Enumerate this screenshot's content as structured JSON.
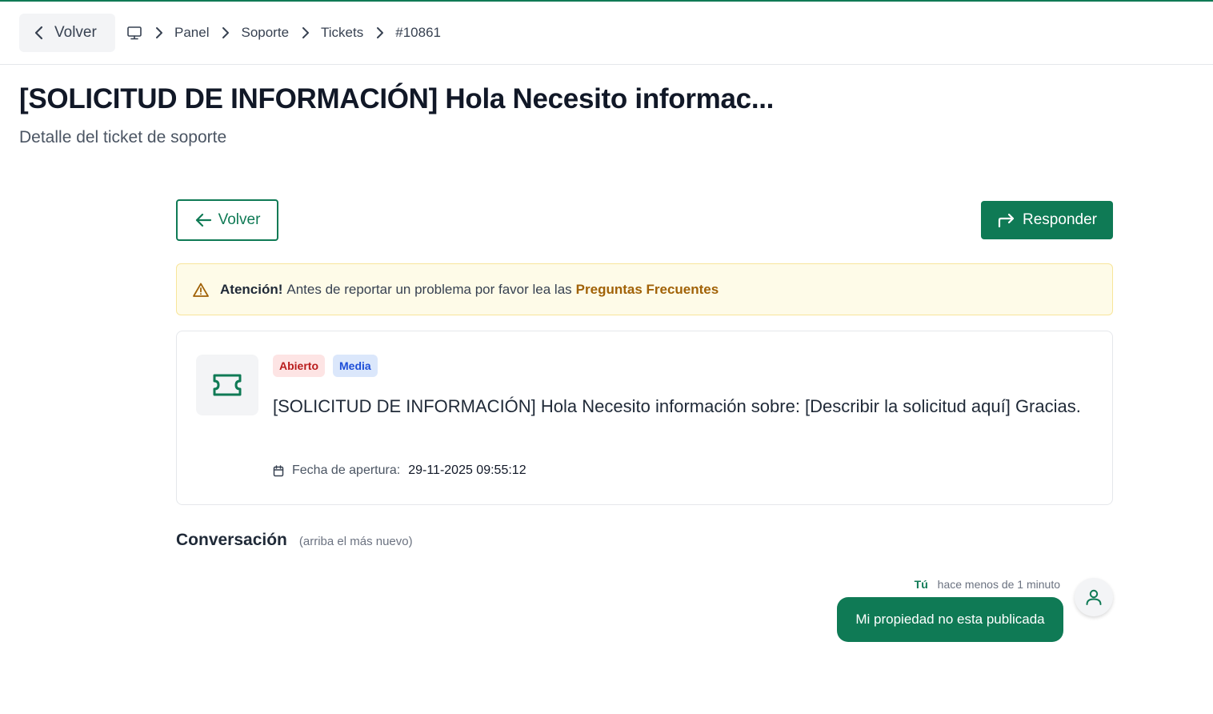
{
  "header": {
    "back_label": "Volver",
    "breadcrumbs": [
      "Panel",
      "Soporte",
      "Tickets",
      "#10861"
    ]
  },
  "page": {
    "title": "[SOLICITUD DE INFORMACIÓN] Hola Necesito informac...",
    "subtitle": "Detalle del ticket de soporte"
  },
  "actions": {
    "back_label": "Volver",
    "reply_label": "Responder"
  },
  "alert": {
    "strong": "Atención!",
    "text": "Antes de reportar un problema por favor lea las",
    "link": "Preguntas Frecuentes"
  },
  "ticket": {
    "status": "Abierto",
    "priority": "Media",
    "text": "[SOLICITUD DE INFORMACIÓN] Hola Necesito información sobre: [Describir la solicitud aquí] Gracias.",
    "date_label": "Fecha de apertura:",
    "date_value": "29-11-2025 09:55:12"
  },
  "conversation": {
    "title": "Conversación",
    "note": "(arriba el más nuevo)",
    "messages": [
      {
        "author": "Tú",
        "time": "hace menos de 1 minuto",
        "text": "Mi propiedad no esta publicada"
      }
    ]
  },
  "colors": {
    "brand": "#0f7a55",
    "alert_bg": "#fefbe8",
    "badge_open": "#b91c1c",
    "badge_media": "#1d4ed8"
  },
  "icons": {
    "header_back": "chevron-left-icon",
    "breadcrumb_home": "monitor-icon",
    "breadcrumb_sep": "chevron-right-icon",
    "back": "arrow-left-icon",
    "reply": "reply-arrow-icon",
    "alert": "warning-triangle-icon",
    "ticket": "ticket-icon",
    "date": "calendar-icon",
    "avatar": "user-icon"
  }
}
